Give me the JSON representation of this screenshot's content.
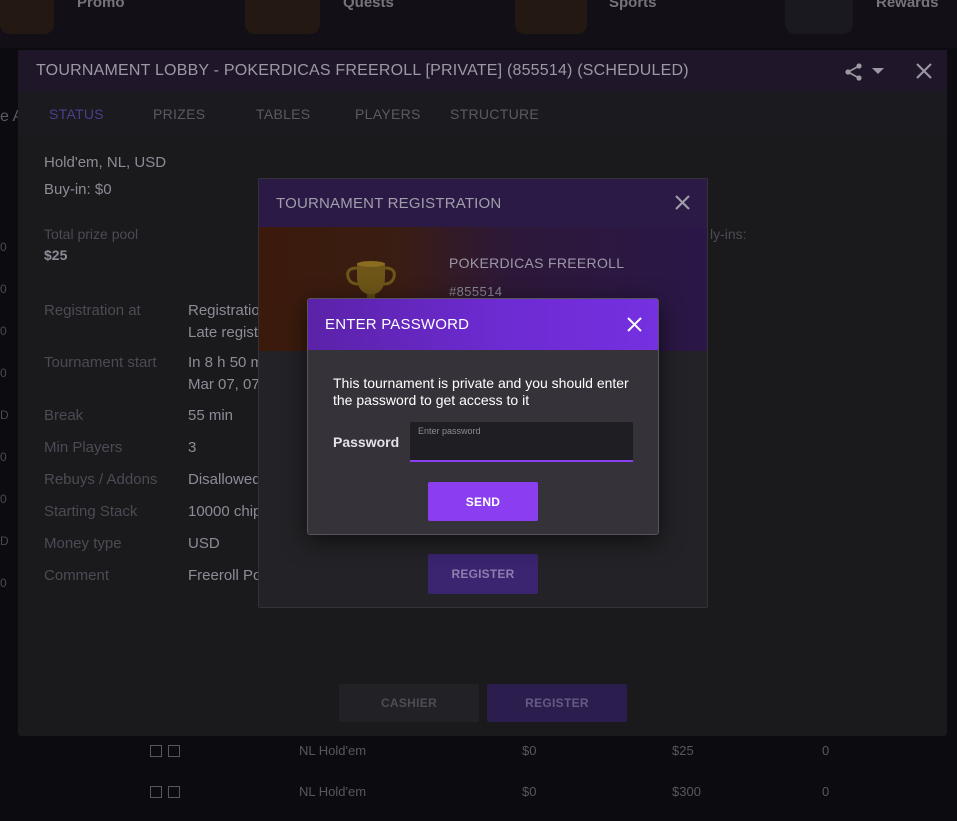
{
  "nav": {
    "items": [
      "Promo",
      "Quests",
      "Sports",
      "Rewards"
    ]
  },
  "background": {
    "left_text": "e A",
    "side_marks": [
      "0",
      "0",
      "0",
      "0",
      "D",
      "0",
      "0",
      "D",
      "0"
    ],
    "rows": [
      {
        "game": "NL Hold'em",
        "buyin": "$0",
        "prize": "$25",
        "players": "0"
      },
      {
        "game": "NL Hold'em",
        "buyin": "$0",
        "prize": "$300",
        "players": "0"
      }
    ]
  },
  "lobby": {
    "title": "TOURNAMENT LOBBY - POKERDICAS FREEROLL [PRIVATE] (855514) (SCHEDULED)",
    "tabs": [
      "STATUS",
      "PRIZES",
      "TABLES",
      "PLAYERS",
      "STRUCTURE"
    ],
    "game_info": "Hold'em, NL, USD",
    "buy_in": "Buy-in: $0",
    "prize_pool_label": "Total prize pool",
    "prize_pool_value": "$25",
    "rebuy_addon_partial": "ly-ins:",
    "details": [
      {
        "label": "Registration at",
        "value": "Registration",
        "value2": "Late registr"
      },
      {
        "label": "Tournament start",
        "value": "In 8 h 50 m",
        "value2": "Mar 07, 07:"
      },
      {
        "label": "Break",
        "value": "55 min"
      },
      {
        "label": "Min Players",
        "value": "3"
      },
      {
        "label": "Rebuys / Addons",
        "value": "Disallowed"
      },
      {
        "label": "Starting Stack",
        "value": "10000 chip"
      },
      {
        "label": "Money type",
        "value": "USD"
      },
      {
        "label": "Comment",
        "value": "Freeroll Pok"
      }
    ],
    "cashier_label": "CASHIER",
    "register_label": "REGISTER"
  },
  "registration": {
    "title": "TOURNAMENT REGISTRATION",
    "tournament_name": "POKERDICAS FREEROLL",
    "tournament_id": "#855514",
    "register_label": "REGISTER"
  },
  "password_dialog": {
    "title": "ENTER PASSWORD",
    "message": "This tournament is private and you should enter the password to get access to it",
    "field_label": "Password",
    "placeholder": "Enter password",
    "value": "",
    "send_label": "SEND",
    "accent_color": "#8a3ef0"
  }
}
